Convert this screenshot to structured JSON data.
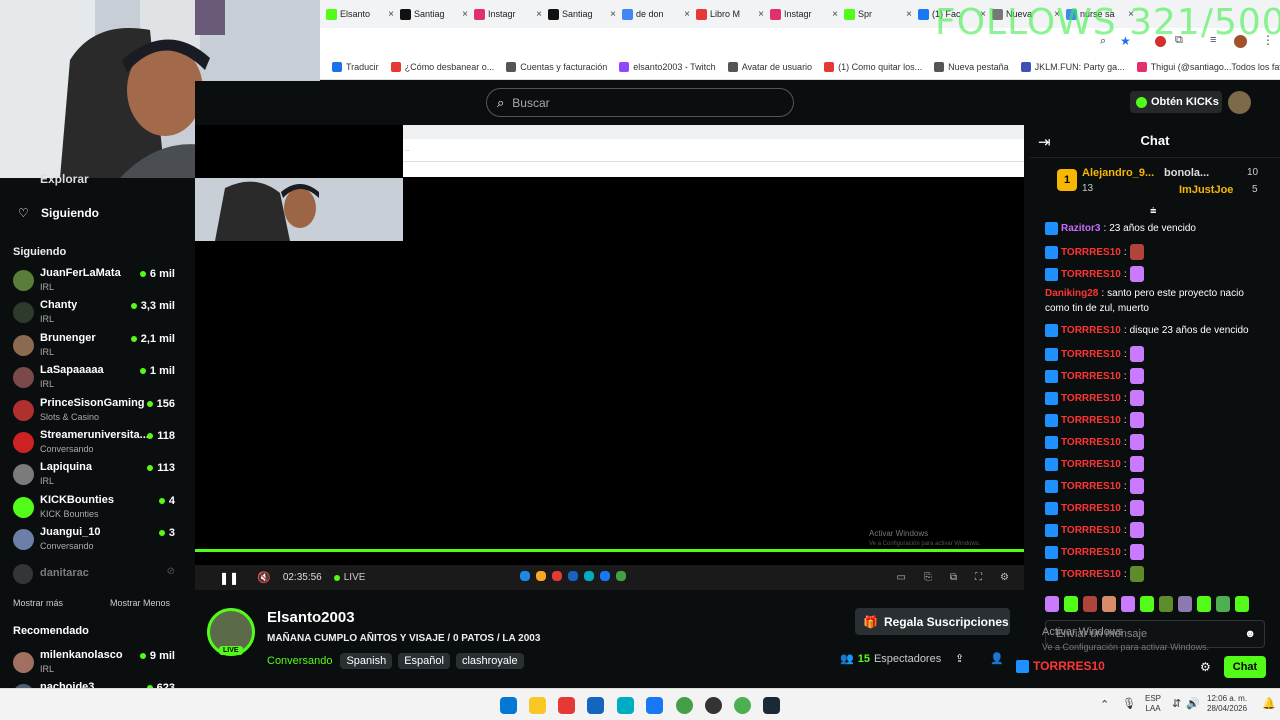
{
  "browser": {
    "tabs": [
      {
        "label": "Elsanto",
        "color": "#53fc18"
      },
      {
        "label": "Santiag",
        "color": "#111111"
      },
      {
        "label": "Instagr",
        "color": "#e1306c"
      },
      {
        "label": "Santiag",
        "color": "#111111"
      },
      {
        "label": "de don",
        "color": "#4285f4"
      },
      {
        "label": "Libro M",
        "color": "#e53935"
      },
      {
        "label": "Instagr",
        "color": "#e1306c"
      },
      {
        "label": "Spr",
        "color": "#53fc18"
      },
      {
        "label": "(1) Fac",
        "color": "#1877f2"
      },
      {
        "label": "Nueva",
        "color": "#777777"
      },
      {
        "label": "nurse sa",
        "color": "#4285f4"
      }
    ],
    "bookmarks": [
      "Traducir",
      "¿Cómo desbanear o...",
      "Cuentas y facturación",
      "elsanto2003 - Twitch",
      "Avatar de usuario",
      "(1) Como quitar los...",
      "Nueva pestaña",
      "JKLM.FUN: Party ga...",
      "Thigui (@santiago..."
    ],
    "all_bookmarks": "Todos los favoritos",
    "overlay_follows": "FOLLOWS 321/500"
  },
  "header": {
    "search_placeholder": "Buscar",
    "get_kicks": "Obtén KICKs"
  },
  "sidebar": {
    "explore": "Explorar",
    "following_nav": "Siguiendo",
    "following_title": "Siguiendo",
    "items": [
      {
        "name": "JuanFerLaMata",
        "cat": "IRL",
        "viewers": "6 mil",
        "color": "#5a7d3a"
      },
      {
        "name": "Chanty",
        "cat": "IRL",
        "viewers": "3,3 mil",
        "color": "#2d3b2b"
      },
      {
        "name": "Brunenger",
        "cat": "IRL",
        "viewers": "2,1 mil",
        "color": "#8c6a4f"
      },
      {
        "name": "LaSapaaaaa",
        "cat": "IRL",
        "viewers": "1 mil",
        "color": "#7a4a4a"
      },
      {
        "name": "PrinceSisonGaming",
        "cat": "Slots & Casino",
        "viewers": "156",
        "color": "#b03030"
      },
      {
        "name": "Streameruniversita...",
        "cat": "Conversando",
        "viewers": "118",
        "color": "#cc2222"
      },
      {
        "name": "Lapiquina",
        "cat": "IRL",
        "viewers": "113",
        "color": "#7b7b7b"
      },
      {
        "name": "KICKBounties",
        "cat": "KICK Bounties",
        "viewers": "4",
        "color": "#53fc18"
      },
      {
        "name": "Juangui_10",
        "cat": "Conversando",
        "viewers": "3",
        "color": "#6b7fa8"
      }
    ],
    "offline": "danitarac",
    "show_more": "Mostrar más",
    "show_less": "Mostrar Menos",
    "recommended_title": "Recomendado",
    "recommended": [
      {
        "name": "milenkanolasco",
        "cat": "IRL",
        "viewers": "9 mil",
        "color": "#a07060"
      },
      {
        "name": "nachoide3",
        "cat": "",
        "viewers": "623",
        "color": "#506070"
      }
    ]
  },
  "player": {
    "time": "02:35:56",
    "live": "LIVE",
    "watermark1": "Activar Windows",
    "watermark2": "Ve a Configuración para activar Windows."
  },
  "channel": {
    "name": "Elsanto2003",
    "live_badge": "LIVE",
    "title": "MAÑANA CUMPLO AÑITOS Y VISAJE / 0 PATOS / LA 2003",
    "category": "Conversando",
    "tags": [
      "Spanish",
      "Español",
      "clashroyale"
    ],
    "gift_subs": "Regala Suscripciones",
    "viewers": "15",
    "viewers_label": "Espectadores"
  },
  "chat": {
    "title": "Chat",
    "top_gifters": [
      {
        "rank": "1",
        "name": "Alejandro_9...",
        "count": "13"
      },
      {
        "name": "bonola...",
        "count": "10"
      },
      {
        "name": "ImJustJoe",
        "count": "5"
      }
    ],
    "messages": [
      {
        "user": "Razitor3",
        "text": "23 años de vencido",
        "style": "purple",
        "badge": true
      },
      {
        "user": "TORRRES10",
        "text": "",
        "style": "red",
        "badge": true,
        "emote": "#b0443a"
      },
      {
        "user": "TORRRES10",
        "text": "",
        "style": "red",
        "badge": true,
        "emote": "#c87bff"
      },
      {
        "user": "Daniking28",
        "text": "santo pero este proyecto nacio",
        "style": "red",
        "badge": false
      },
      {
        "user": "",
        "text": "como tin de zul, muerto",
        "style": "",
        "badge": false
      },
      {
        "user": "TORRRES10",
        "text": "disque 23 años de vencido",
        "style": "red",
        "badge": true
      },
      {
        "user": "TORRRES10",
        "text": "",
        "style": "red",
        "badge": true,
        "emote": "#c87bff"
      },
      {
        "user": "TORRRES10",
        "text": "",
        "style": "red",
        "badge": true,
        "emote": "#c87bff"
      },
      {
        "user": "TORRRES10",
        "text": "",
        "style": "red",
        "badge": true,
        "emote": "#c87bff"
      },
      {
        "user": "TORRRES10",
        "text": "",
        "style": "red",
        "badge": true,
        "emote": "#c87bff"
      },
      {
        "user": "TORRRES10",
        "text": "",
        "style": "red",
        "badge": true,
        "emote": "#c87bff"
      },
      {
        "user": "TORRRES10",
        "text": "",
        "style": "red",
        "badge": true,
        "emote": "#c87bff"
      },
      {
        "user": "TORRRES10",
        "text": "",
        "style": "red",
        "badge": true,
        "emote": "#c87bff"
      },
      {
        "user": "TORRRES10",
        "text": "",
        "style": "red",
        "badge": true,
        "emote": "#c87bff"
      },
      {
        "user": "TORRRES10",
        "text": "",
        "style": "red",
        "badge": true,
        "emote": "#c87bff"
      },
      {
        "user": "TORRRES10",
        "text": "",
        "style": "red",
        "badge": true,
        "emote": "#c87bff"
      },
      {
        "user": "TORRRES10",
        "text": "",
        "style": "red",
        "badge": true,
        "emote": "#5e8c2a"
      }
    ],
    "input_placeholder": "Enviar un mensaje",
    "send_label": "Chat",
    "overlay_user": "TORRRES10"
  },
  "taskbar": {
    "lang1": "ESP",
    "lang2": "LAA",
    "time": "12:06 a. m.",
    "date": "28/04/2026"
  }
}
